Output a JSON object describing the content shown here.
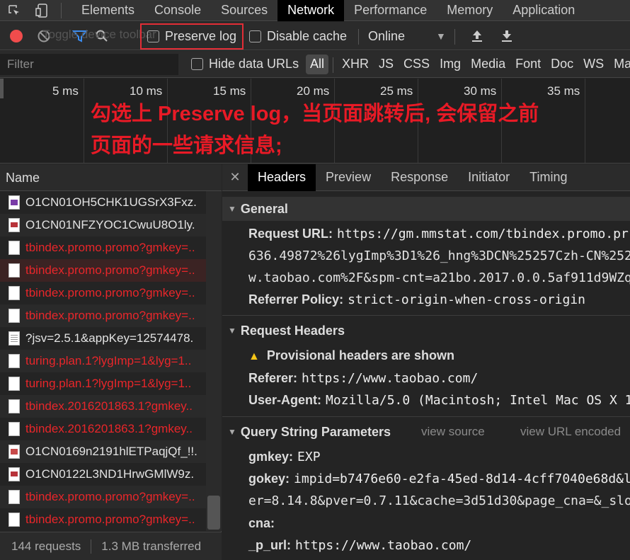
{
  "top_tabs": [
    "Elements",
    "Console",
    "Sources",
    "Network",
    "Performance",
    "Memory",
    "Application"
  ],
  "active_tab": "Network",
  "toolbar": {
    "ghost_text": "Toggle device toolbar",
    "preserve_log": "Preserve log",
    "disable_cache": "Disable cache",
    "throttle": "Online"
  },
  "filterbar": {
    "filter_placeholder": "Filter",
    "hide_data_urls": "Hide data URLs",
    "types": [
      "All",
      "XHR",
      "JS",
      "CSS",
      "Img",
      "Media",
      "Font",
      "Doc",
      "WS",
      "Ma"
    ]
  },
  "overview": {
    "ticks": [
      "5 ms",
      "10 ms",
      "15 ms",
      "20 ms",
      "25 ms",
      "30 ms",
      "35 ms"
    ],
    "annotation_line1": "勾选上 Preserve log，当页面跳转后, 会保留之前",
    "annotation_line2": "页面的一些请求信息;"
  },
  "request_list": {
    "header": "Name",
    "rows": [
      {
        "name": "O1CN01OH5CHK1UGSrX3Fxz.",
        "status": "ok",
        "icon": "img"
      },
      {
        "name": "O1CN01NFZYOC1CwuU8O1ly.",
        "status": "ok",
        "icon": "img2"
      },
      {
        "name": "tbindex.promo.promo?gmkey=..",
        "status": "err",
        "icon": "blank"
      },
      {
        "name": "tbindex.promo.promo?gmkey=..",
        "status": "err",
        "icon": "blank"
      },
      {
        "name": "tbindex.promo.promo?gmkey=..",
        "status": "err",
        "icon": "blank"
      },
      {
        "name": "tbindex.promo.promo?gmkey=..",
        "status": "err",
        "icon": "blank"
      },
      {
        "name": "?jsv=2.5.1&appKey=12574478.",
        "status": "ok",
        "icon": "doc"
      },
      {
        "name": "turing.plan.1?lygImp=1&lyg=1..",
        "status": "err",
        "icon": "blank"
      },
      {
        "name": "turing.plan.1?lygImp=1&lyg=1..",
        "status": "err",
        "icon": "blank"
      },
      {
        "name": "tbindex.2016201863.1?gmkey..",
        "status": "err",
        "icon": "blank"
      },
      {
        "name": "tbindex.2016201863.1?gmkey..",
        "status": "err",
        "icon": "blank"
      },
      {
        "name": "O1CN0169n2191hlETPaqjQf_!!.",
        "status": "ok",
        "icon": "img3"
      },
      {
        "name": "O1CN0122L3ND1HrwGMlW9z.",
        "status": "ok",
        "icon": "img2"
      },
      {
        "name": "tbindex.promo.promo?gmkey=..",
        "status": "err",
        "icon": "blank"
      },
      {
        "name": "tbindex.promo.promo?gmkey=..",
        "status": "err",
        "icon": "blank"
      }
    ],
    "selected_index": 3,
    "requests_count": "144 requests",
    "transferred": "1.3 MB transferred"
  },
  "detail": {
    "tabs": [
      "Headers",
      "Preview",
      "Response",
      "Initiator",
      "Timing"
    ],
    "active_tab": "Headers",
    "general": {
      "title": "General",
      "request_url_label": "Request URL:",
      "request_url_value": "https://gm.mmstat.com/tbindex.promo.pr",
      "request_url_line2": "636.49872%26lygImp%3D1%26_hng%3DCN%25257Czh-CN%252",
      "request_url_line3": "w.taobao.com%2F&spm-cnt=a21bo.2017.0.0.5af911d9WZq",
      "referrer_policy_label": "Referrer Policy:",
      "referrer_policy_value": "strict-origin-when-cross-origin"
    },
    "request_headers": {
      "title": "Request Headers",
      "provisional": "Provisional headers are shown",
      "referer_label": "Referer:",
      "referer_value": "https://www.taobao.com/",
      "ua_label": "User-Agent:",
      "ua_value": "Mozilla/5.0 (Macintosh; Intel Mac OS X 1"
    },
    "query": {
      "title": "Query String Parameters",
      "view_source": "view source",
      "view_encoded": "view URL encoded",
      "gmkey_label": "gmkey:",
      "gmkey_value": "EXP",
      "gokey_label": "gokey:",
      "gokey_value": "impid=b7476e60-e2fa-45ed-8d14-4cff7040e68d&l",
      "gokey_line2": "er=8.14.8&pver=0.7.11&cache=3d51d30&page_cna=&_slo",
      "cna_label": "cna:",
      "p_url_label": "_p_url:",
      "p_url_value": "https://www.taobao.com/"
    }
  },
  "colors": {
    "accent_red": "#e81a26",
    "error_row": "#e8262a",
    "record": "#f14c4c",
    "filter_icon": "#3b8cf0",
    "warning": "#f5c518"
  }
}
